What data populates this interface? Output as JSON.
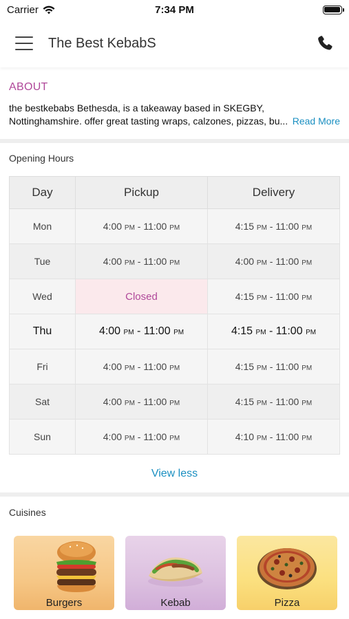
{
  "status_bar": {
    "carrier": "Carrier",
    "time": "7:34 PM"
  },
  "header": {
    "title": "The Best KebabS"
  },
  "about": {
    "title": "ABOUT",
    "line1": "the bestkebabs Bethesda, is a takeaway based in SKEGBY,",
    "line2": "Nottinghamshire. offer great tasting wraps, calzones, pizzas, bu...",
    "read_more": "Read More"
  },
  "opening_hours": {
    "label": "Opening Hours",
    "columns": [
      "Day",
      "Pickup",
      "Delivery"
    ],
    "rows": [
      {
        "day": "Mon",
        "pickup": [
          "4:00",
          "PM",
          " - 11:00",
          "PM"
        ],
        "delivery": [
          "4:15",
          "PM",
          " - 11:00",
          "PM"
        ]
      },
      {
        "day": "Tue",
        "pickup": [
          "4:00",
          "PM",
          " - 11:00",
          "PM"
        ],
        "delivery": [
          "4:00",
          "PM",
          " - 11:00",
          "PM"
        ]
      },
      {
        "day": "Wed",
        "pickup_closed": "Closed",
        "delivery": [
          "4:15",
          "PM",
          " - 11:00",
          "PM"
        ]
      },
      {
        "day": "Thu",
        "pickup": [
          "4:00",
          "PM",
          " - 11:00",
          "PM"
        ],
        "delivery": [
          "4:15",
          "PM",
          " - 11:00",
          "PM"
        ]
      },
      {
        "day": "Fri",
        "pickup": [
          "4:00",
          "PM",
          " - 11:00",
          "PM"
        ],
        "delivery": [
          "4:15",
          "PM",
          " - 11:00",
          "PM"
        ]
      },
      {
        "day": "Sat",
        "pickup": [
          "4:00",
          "PM",
          " - 11:00",
          "PM"
        ],
        "delivery": [
          "4:15",
          "PM",
          " - 11:00",
          "PM"
        ]
      },
      {
        "day": "Sun",
        "pickup": [
          "4:00",
          "PM",
          " - 11:00",
          "PM"
        ],
        "delivery": [
          "4:10",
          "PM",
          " - 11:00",
          "PM"
        ]
      }
    ],
    "toggle": "View less"
  },
  "cuisines": {
    "label": "Cuisines",
    "items": [
      {
        "name": "Burgers",
        "icon": "burger-image"
      },
      {
        "name": "Kebab",
        "icon": "kebab-image"
      },
      {
        "name": "Pizza",
        "icon": "pizza-image"
      }
    ]
  },
  "colors": {
    "accent": "#b0489a",
    "link": "#1a8fc1",
    "closed_bg": "#fbe9ec"
  }
}
